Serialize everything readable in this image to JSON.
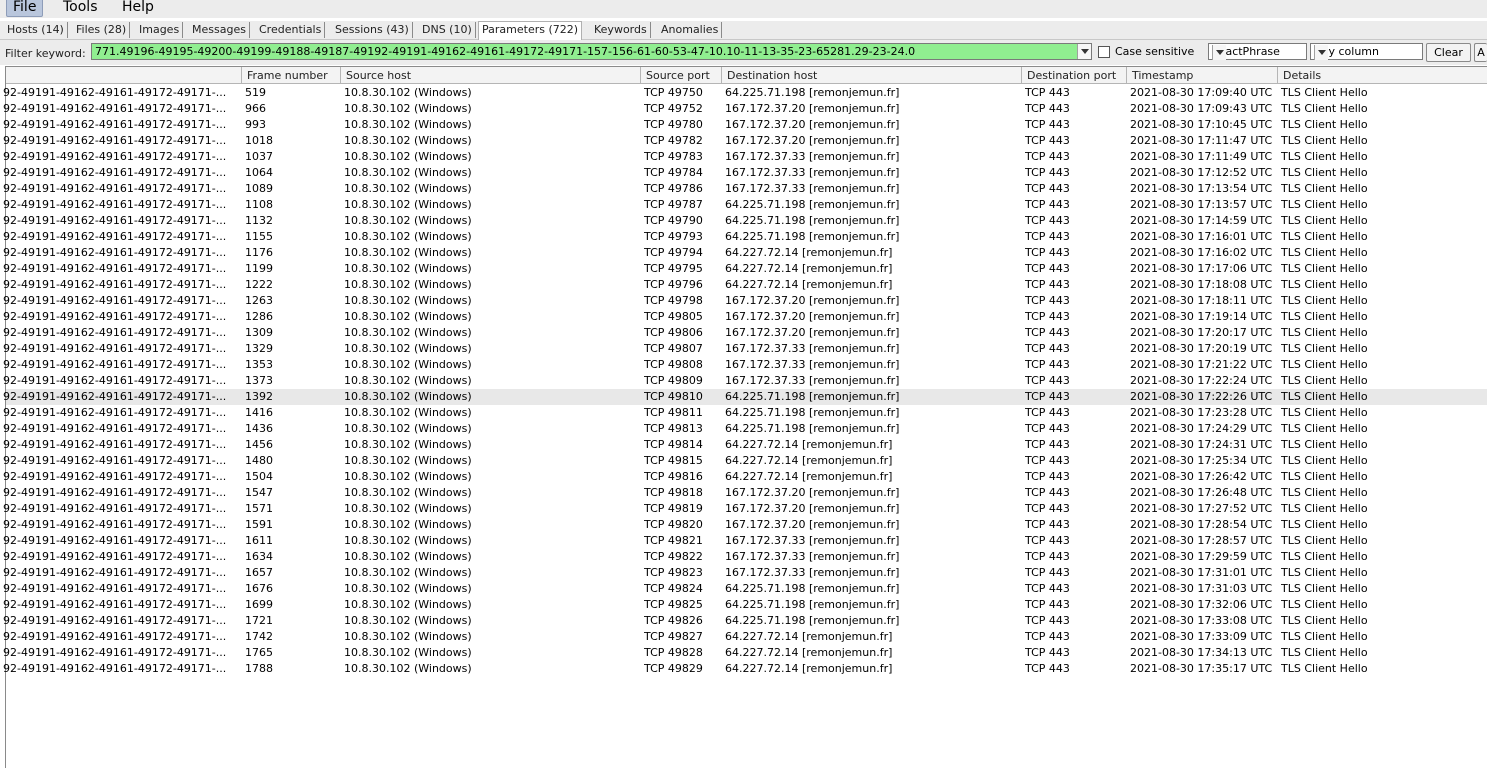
{
  "menu": [
    {
      "label": "File"
    },
    {
      "label": "Tools"
    },
    {
      "label": "Help"
    }
  ],
  "tabs": [
    {
      "label": "Hosts (14)"
    },
    {
      "label": "Files (28)"
    },
    {
      "label": "Images"
    },
    {
      "label": "Messages"
    },
    {
      "label": "Credentials"
    },
    {
      "label": "Sessions (43)"
    },
    {
      "label": "DNS (10)"
    },
    {
      "label": "Parameters (722)"
    },
    {
      "label": "Keywords"
    },
    {
      "label": "Anomalies"
    }
  ],
  "filter": {
    "label": "Filter keyword:",
    "value": "771.49196-49195-49200-49199-49188-49187-49192-49191-49162-49161-49172-49171-157-156-61-60-53-47-10.10-11-13-35-23-65281.29-23-24.0",
    "case_sensitive_label": "Case sensitive",
    "match_mode": "ExactPhrase",
    "column_scope": "Any column",
    "clear_label": "Clear",
    "apply_label": "A",
    "input_color": "#90ee90"
  },
  "table": {
    "columns": [
      "",
      "Frame number",
      "Source host",
      "Source port",
      "Destination host",
      "Destination port",
      "Timestamp",
      "Details"
    ],
    "param_prefix": "92-49191-49162-49161-49172-49171-...",
    "source_host": "10.8.30.102 (Windows)",
    "dest_port": "TCP 443",
    "details": "TLS Client Hello",
    "highlight_row": 19,
    "rows": [
      {
        "frame": "519",
        "sport": "TCP 49750",
        "dhost": "64.225.71.198 [remonjemun.fr]",
        "ts": "2021-08-30 17:09:40 UTC"
      },
      {
        "frame": "966",
        "sport": "TCP 49752",
        "dhost": "167.172.37.20 [remonjemun.fr]",
        "ts": "2021-08-30 17:09:43 UTC"
      },
      {
        "frame": "993",
        "sport": "TCP 49780",
        "dhost": "167.172.37.20 [remonjemun.fr]",
        "ts": "2021-08-30 17:10:45 UTC"
      },
      {
        "frame": "1018",
        "sport": "TCP 49782",
        "dhost": "167.172.37.20 [remonjemun.fr]",
        "ts": "2021-08-30 17:11:47 UTC"
      },
      {
        "frame": "1037",
        "sport": "TCP 49783",
        "dhost": "167.172.37.33 [remonjemun.fr]",
        "ts": "2021-08-30 17:11:49 UTC"
      },
      {
        "frame": "1064",
        "sport": "TCP 49784",
        "dhost": "167.172.37.33 [remonjemun.fr]",
        "ts": "2021-08-30 17:12:52 UTC"
      },
      {
        "frame": "1089",
        "sport": "TCP 49786",
        "dhost": "167.172.37.33 [remonjemun.fr]",
        "ts": "2021-08-30 17:13:54 UTC"
      },
      {
        "frame": "1108",
        "sport": "TCP 49787",
        "dhost": "64.225.71.198 [remonjemun.fr]",
        "ts": "2021-08-30 17:13:57 UTC"
      },
      {
        "frame": "1132",
        "sport": "TCP 49790",
        "dhost": "64.225.71.198 [remonjemun.fr]",
        "ts": "2021-08-30 17:14:59 UTC"
      },
      {
        "frame": "1155",
        "sport": "TCP 49793",
        "dhost": "64.225.71.198 [remonjemun.fr]",
        "ts": "2021-08-30 17:16:01 UTC"
      },
      {
        "frame": "1176",
        "sport": "TCP 49794",
        "dhost": "64.227.72.14 [remonjemun.fr]",
        "ts": "2021-08-30 17:16:02 UTC"
      },
      {
        "frame": "1199",
        "sport": "TCP 49795",
        "dhost": "64.227.72.14 [remonjemun.fr]",
        "ts": "2021-08-30 17:17:06 UTC"
      },
      {
        "frame": "1222",
        "sport": "TCP 49796",
        "dhost": "64.227.72.14 [remonjemun.fr]",
        "ts": "2021-08-30 17:18:08 UTC"
      },
      {
        "frame": "1263",
        "sport": "TCP 49798",
        "dhost": "167.172.37.20 [remonjemun.fr]",
        "ts": "2021-08-30 17:18:11 UTC"
      },
      {
        "frame": "1286",
        "sport": "TCP 49805",
        "dhost": "167.172.37.20 [remonjemun.fr]",
        "ts": "2021-08-30 17:19:14 UTC"
      },
      {
        "frame": "1309",
        "sport": "TCP 49806",
        "dhost": "167.172.37.20 [remonjemun.fr]",
        "ts": "2021-08-30 17:20:17 UTC"
      },
      {
        "frame": "1329",
        "sport": "TCP 49807",
        "dhost": "167.172.37.33 [remonjemun.fr]",
        "ts": "2021-08-30 17:20:19 UTC"
      },
      {
        "frame": "1353",
        "sport": "TCP 49808",
        "dhost": "167.172.37.33 [remonjemun.fr]",
        "ts": "2021-08-30 17:21:22 UTC"
      },
      {
        "frame": "1373",
        "sport": "TCP 49809",
        "dhost": "167.172.37.33 [remonjemun.fr]",
        "ts": "2021-08-30 17:22:24 UTC"
      },
      {
        "frame": "1392",
        "sport": "TCP 49810",
        "dhost": "64.225.71.198 [remonjemun.fr]",
        "ts": "2021-08-30 17:22:26 UTC"
      },
      {
        "frame": "1416",
        "sport": "TCP 49811",
        "dhost": "64.225.71.198 [remonjemun.fr]",
        "ts": "2021-08-30 17:23:28 UTC"
      },
      {
        "frame": "1436",
        "sport": "TCP 49813",
        "dhost": "64.225.71.198 [remonjemun.fr]",
        "ts": "2021-08-30 17:24:29 UTC"
      },
      {
        "frame": "1456",
        "sport": "TCP 49814",
        "dhost": "64.227.72.14 [remonjemun.fr]",
        "ts": "2021-08-30 17:24:31 UTC"
      },
      {
        "frame": "1480",
        "sport": "TCP 49815",
        "dhost": "64.227.72.14 [remonjemun.fr]",
        "ts": "2021-08-30 17:25:34 UTC"
      },
      {
        "frame": "1504",
        "sport": "TCP 49816",
        "dhost": "64.227.72.14 [remonjemun.fr]",
        "ts": "2021-08-30 17:26:42 UTC"
      },
      {
        "frame": "1547",
        "sport": "TCP 49818",
        "dhost": "167.172.37.20 [remonjemun.fr]",
        "ts": "2021-08-30 17:26:48 UTC"
      },
      {
        "frame": "1571",
        "sport": "TCP 49819",
        "dhost": "167.172.37.20 [remonjemun.fr]",
        "ts": "2021-08-30 17:27:52 UTC"
      },
      {
        "frame": "1591",
        "sport": "TCP 49820",
        "dhost": "167.172.37.20 [remonjemun.fr]",
        "ts": "2021-08-30 17:28:54 UTC"
      },
      {
        "frame": "1611",
        "sport": "TCP 49821",
        "dhost": "167.172.37.33 [remonjemun.fr]",
        "ts": "2021-08-30 17:28:57 UTC"
      },
      {
        "frame": "1634",
        "sport": "TCP 49822",
        "dhost": "167.172.37.33 [remonjemun.fr]",
        "ts": "2021-08-30 17:29:59 UTC"
      },
      {
        "frame": "1657",
        "sport": "TCP 49823",
        "dhost": "167.172.37.33 [remonjemun.fr]",
        "ts": "2021-08-30 17:31:01 UTC"
      },
      {
        "frame": "1676",
        "sport": "TCP 49824",
        "dhost": "64.225.71.198 [remonjemun.fr]",
        "ts": "2021-08-30 17:31:03 UTC"
      },
      {
        "frame": "1699",
        "sport": "TCP 49825",
        "dhost": "64.225.71.198 [remonjemun.fr]",
        "ts": "2021-08-30 17:32:06 UTC"
      },
      {
        "frame": "1721",
        "sport": "TCP 49826",
        "dhost": "64.225.71.198 [remonjemun.fr]",
        "ts": "2021-08-30 17:33:08 UTC"
      },
      {
        "frame": "1742",
        "sport": "TCP 49827",
        "dhost": "64.227.72.14 [remonjemun.fr]",
        "ts": "2021-08-30 17:33:09 UTC"
      },
      {
        "frame": "1765",
        "sport": "TCP 49828",
        "dhost": "64.227.72.14 [remonjemun.fr]",
        "ts": "2021-08-30 17:34:13 UTC"
      },
      {
        "frame": "1788",
        "sport": "TCP 49829",
        "dhost": "64.227.72.14 [remonjemun.fr]",
        "ts": "2021-08-30 17:35:17 UTC"
      }
    ]
  }
}
